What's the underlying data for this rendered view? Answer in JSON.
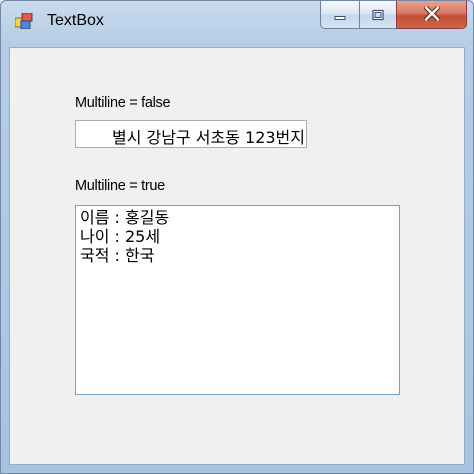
{
  "window": {
    "title": "TextBox",
    "icon": "app-window-icon",
    "controls": [
      "minimize-icon",
      "maximize-icon",
      "close-icon"
    ],
    "close_color": "#c9503a"
  },
  "form": {
    "label_single": "Multiline = false",
    "single_value": "별시 강남구 서초동 123번지",
    "label_multi": "Multiline = true",
    "multi_lines": [
      "이름 : 홍길동",
      "나이 : 25세",
      "국적 : 한국"
    ]
  }
}
